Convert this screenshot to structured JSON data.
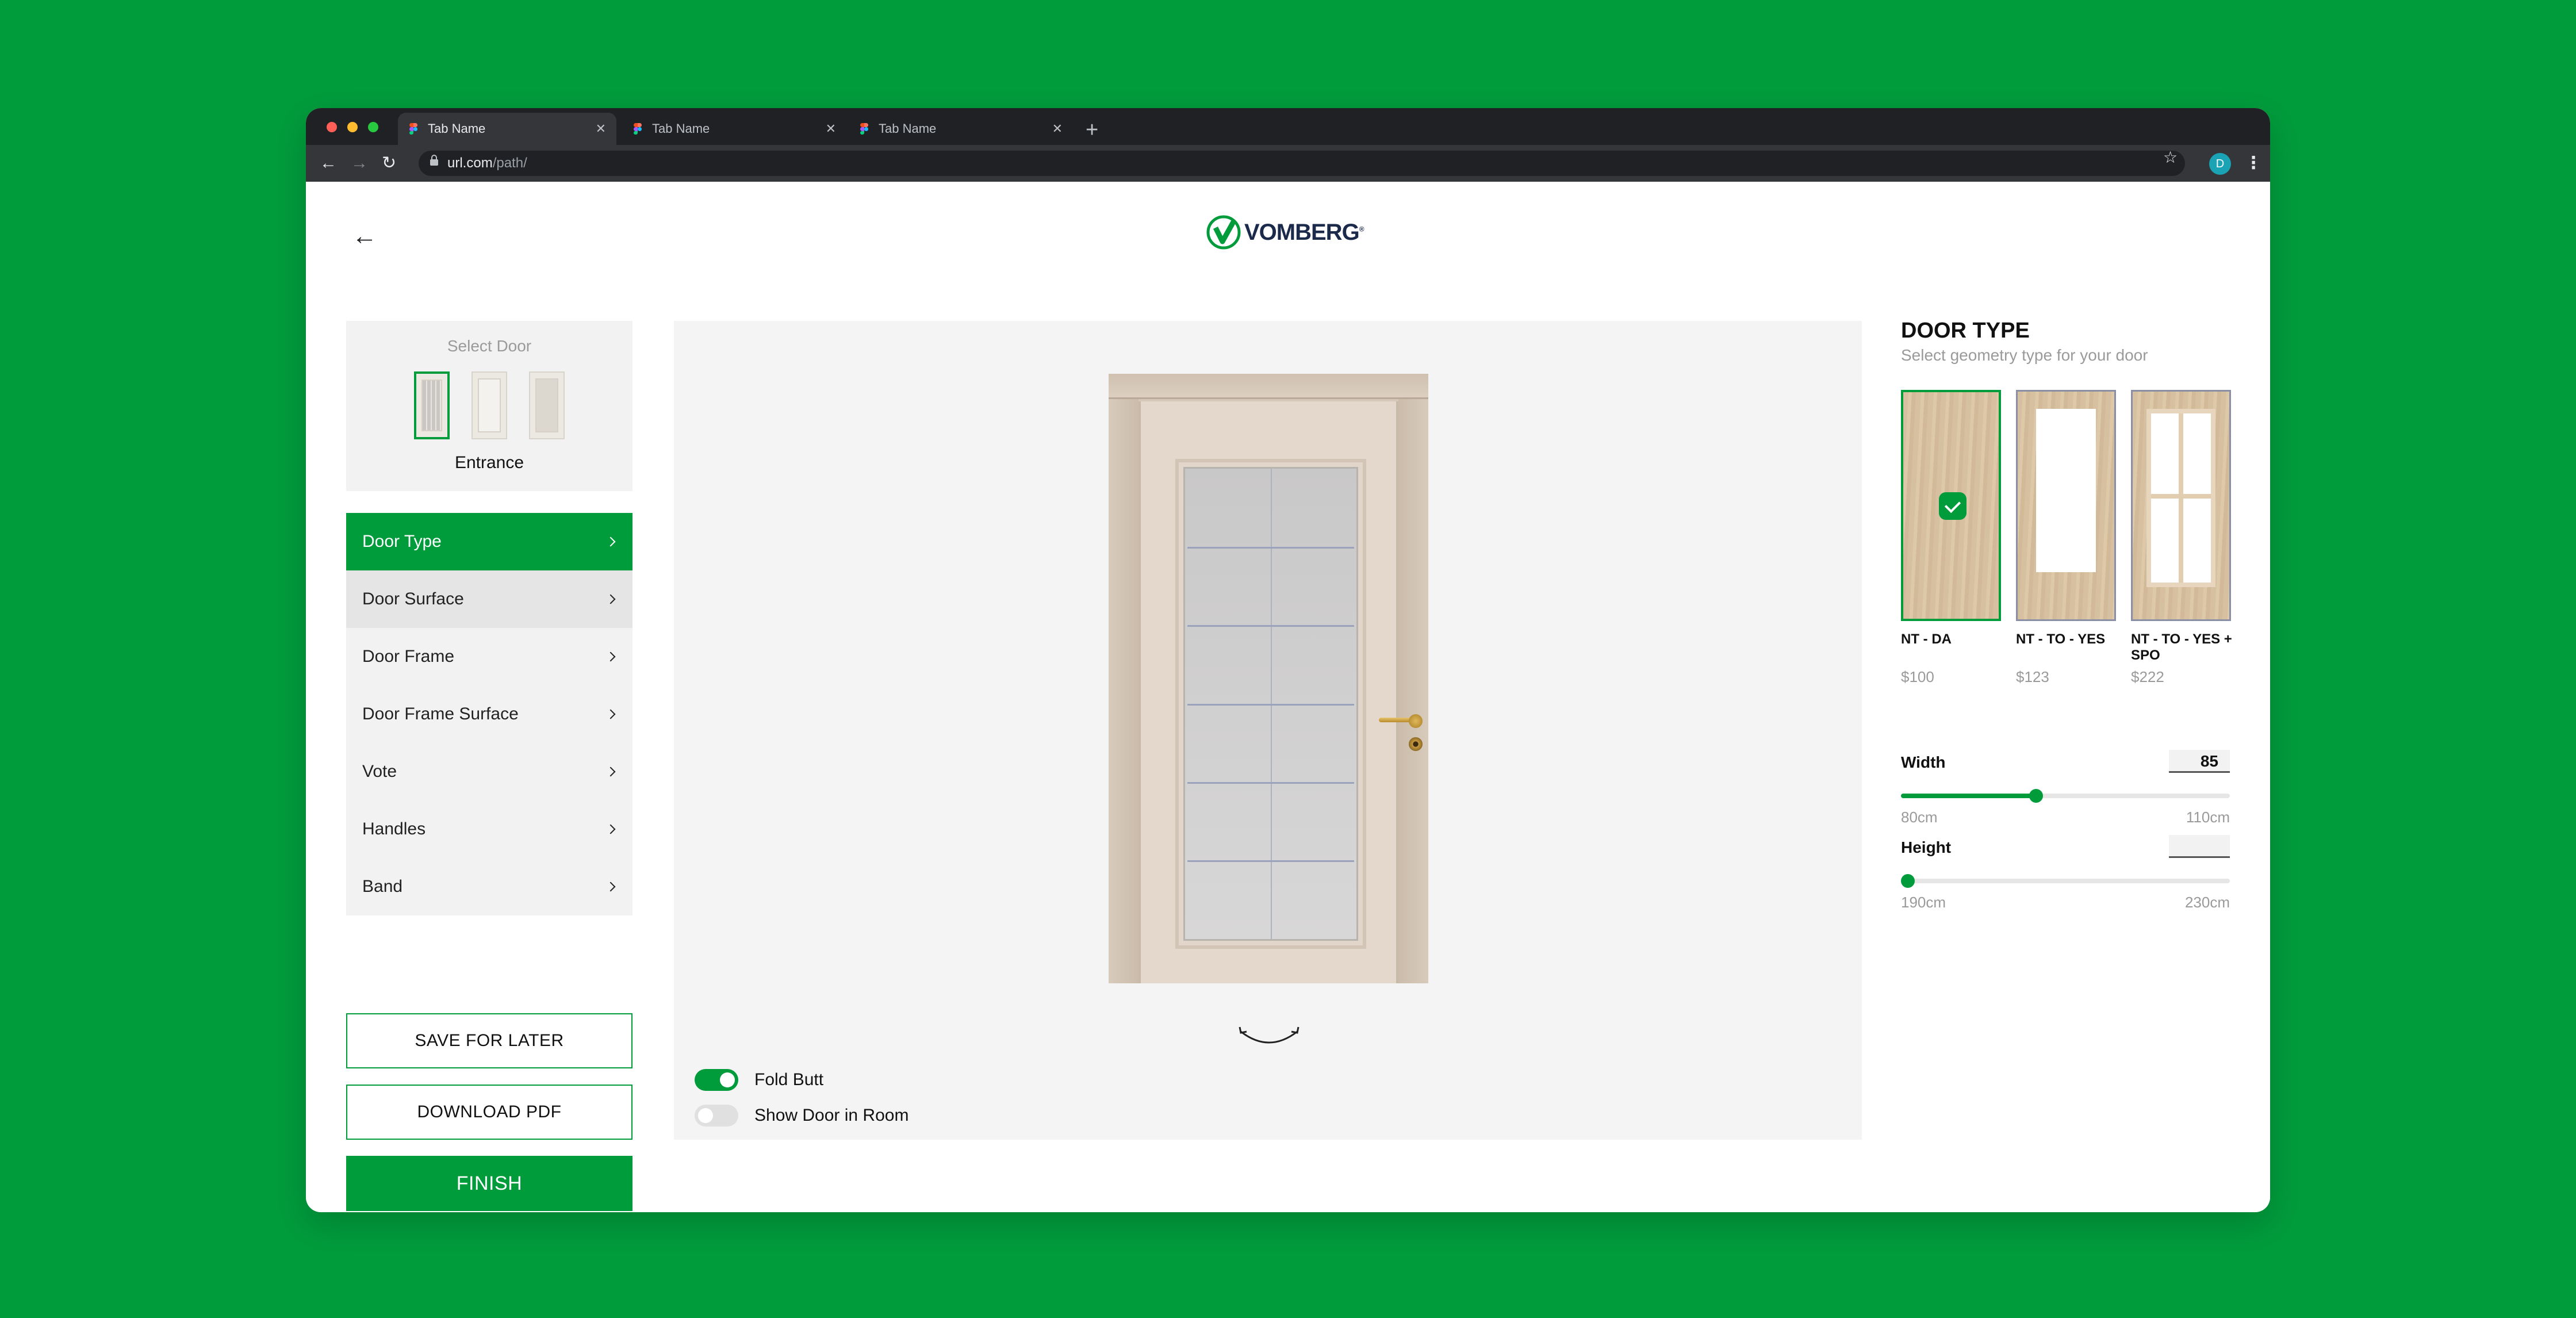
{
  "browser": {
    "tabs": [
      {
        "title": "Tab Name",
        "active": true
      },
      {
        "title": "Tab Name",
        "active": false
      },
      {
        "title": "Tab Name",
        "active": false
      }
    ],
    "url_host": "url.com",
    "url_path": "/path/",
    "profile_initial": "D"
  },
  "header": {
    "logo_text": "VOMBERG"
  },
  "select_door": {
    "title": "Select Door",
    "selected_name": "Entrance"
  },
  "menu": [
    {
      "label": "Door Type",
      "state": "active"
    },
    {
      "label": "Door Surface",
      "state": "hover"
    },
    {
      "label": "Door Frame",
      "state": "normal"
    },
    {
      "label": "Door Frame Surface",
      "state": "normal"
    },
    {
      "label": "Vote",
      "state": "normal"
    },
    {
      "label": "Handles",
      "state": "normal"
    },
    {
      "label": "Band",
      "state": "normal"
    }
  ],
  "actions": {
    "save_label": "SAVE FOR LATER",
    "download_label": "DOWNLOAD PDF",
    "finish_label": "FINISH"
  },
  "preview": {
    "fold_butt_label": "Fold Butt",
    "fold_butt_on": true,
    "show_room_label": "Show Door in Room",
    "show_room_on": false
  },
  "door_type": {
    "title": "DOOR TYPE",
    "subtitle": "Select geometry type for your door",
    "options": [
      {
        "name": "NT - DA",
        "price": "$100",
        "selected": true
      },
      {
        "name": "NT - TO - YES",
        "price": "$123",
        "selected": false
      },
      {
        "name": "NT - TO - YES + SPO",
        "price": "$222",
        "selected": false
      }
    ]
  },
  "dimensions": {
    "width": {
      "label": "Width",
      "value": "85",
      "min": "80cm",
      "max": "110cm",
      "fraction": 0.41
    },
    "height": {
      "label": "Height",
      "value": "",
      "min": "190cm",
      "max": "230cm",
      "fraction": 0.0
    }
  },
  "colors": {
    "brand_green": "#009c3c",
    "logo_navy": "#1b2a4a"
  }
}
